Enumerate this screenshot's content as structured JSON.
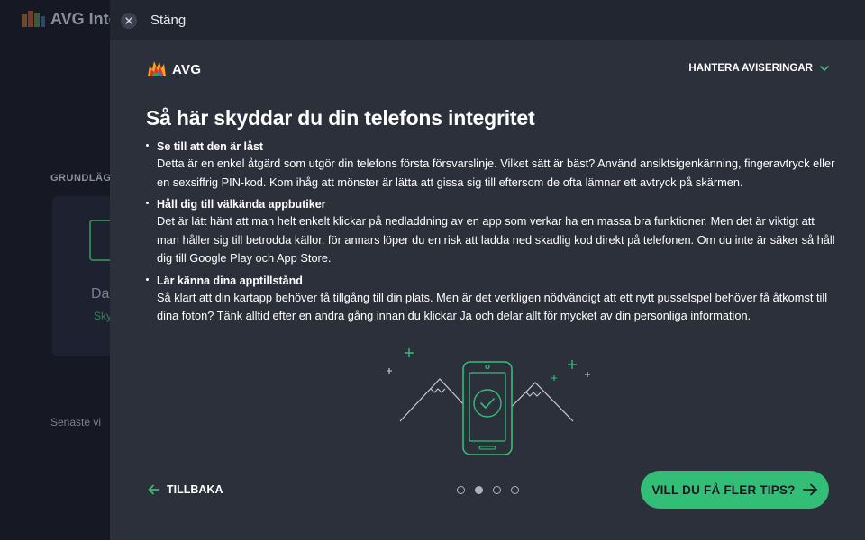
{
  "background": {
    "app_name": "AVG Inte",
    "section_heading": "GRUNDLÄG",
    "card_title": "Da",
    "card_subtitle": "Sky",
    "recent_label": "Senaste vi"
  },
  "topbar": {
    "close_label": "Stäng",
    "close_icon": "close-icon"
  },
  "panel": {
    "brand": "AVG",
    "manage_notifications": "HANTERA AVISERINGAR",
    "title": "Så här skyddar du din telefons integritet",
    "tips": [
      {
        "heading": "Se till att den är låst",
        "body": "Detta är en enkel åtgärd som utgör din telefons första försvarslinje. Vilket sätt är bäst? Använd ansiktsigenkänning, fingeravtryck eller en sexsiffrig PIN-kod. Kom ihåg att mönster är lätta att gissa sig till eftersom de ofta lämnar ett avtryck på skärmen."
      },
      {
        "heading": "Håll dig till välkända appbutiker",
        "body": "Det är lätt hänt att man helt enkelt klickar på nedladdning av en app som verkar ha en massa bra funktioner. Men det är viktigt att man håller sig till betrodda källor, för annars löper du en risk att ladda ned skadlig kod direkt på telefonen. Om du inte är säker så håll dig till Google Play och App Store."
      },
      {
        "heading": "Lär känna dina apptillstånd",
        "body": "Så klart att din kartapp behöver få tillgång till din plats. Men är det verkligen nödvändigt att ett nytt pusselspel behöver få åtkomst till dina foton? Tänk alltid efter en andra gång innan du klickar Ja och delar allt för mycket av din personliga information."
      }
    ],
    "back_label": "TILLBAKA",
    "more_tips_label": "VILL DU FÅ FLER TIPS?",
    "pagination": {
      "total": 4,
      "current": 2
    }
  },
  "colors": {
    "accent": "#33be78",
    "panel_bg": "#2c303b",
    "topbar_bg": "#222631",
    "app_bg": "#161923"
  }
}
